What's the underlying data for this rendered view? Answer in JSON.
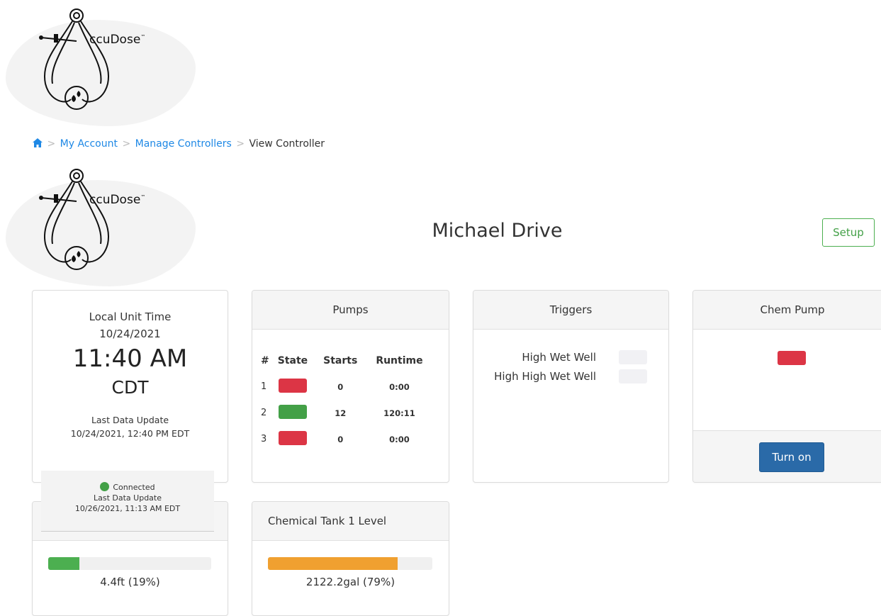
{
  "logo": {
    "brand": "ccuDose",
    "tm": "™"
  },
  "breadcrumb": {
    "items": [
      "My Account",
      "Manage Controllers"
    ],
    "current": "View Controller",
    "separator": ">"
  },
  "page": {
    "title": "Michael Drive",
    "setup_label": "Setup"
  },
  "local_time": {
    "label": "Local Unit Time",
    "date": "10/24/2021",
    "time": "11:40 AM",
    "timezone": "CDT",
    "last_update_label": "Last Data Update",
    "last_update": "10/24/2021, 12:40 PM EDT"
  },
  "connection": {
    "status": "Connected",
    "last_update_label": "Last Data Update",
    "last_update": "10/26/2021, 11:13 AM EDT",
    "color": "#43a047"
  },
  "pumps": {
    "title": "Pumps",
    "headers": [
      "#",
      "State",
      "Starts",
      "Runtime"
    ],
    "rows": [
      {
        "num": "1",
        "state": "off",
        "starts": "0",
        "runtime": "0:00"
      },
      {
        "num": "2",
        "state": "on",
        "starts": "12",
        "runtime": "120:11"
      },
      {
        "num": "3",
        "state": "off",
        "starts": "0",
        "runtime": "0:00"
      }
    ],
    "colors": {
      "on": "#43a047",
      "off": "#dc3545"
    }
  },
  "triggers": {
    "title": "Triggers",
    "items": [
      {
        "label": "High Wet Well",
        "state": "inactive"
      },
      {
        "label": "High High Wet Well",
        "state": "inactive"
      }
    ]
  },
  "chem_pump": {
    "title": "Chem Pump",
    "state": "off",
    "color": "#dc3545",
    "button_label": "Turn on"
  },
  "wet_well_level": {
    "value_text": "4.4ft (19%)",
    "percent": 19,
    "color": "#4caf50"
  },
  "chem_tank": {
    "title": "Chemical Tank 1 Level",
    "value_text": "2122.2gal (79%)",
    "percent": 79,
    "color": "#f0a030"
  }
}
